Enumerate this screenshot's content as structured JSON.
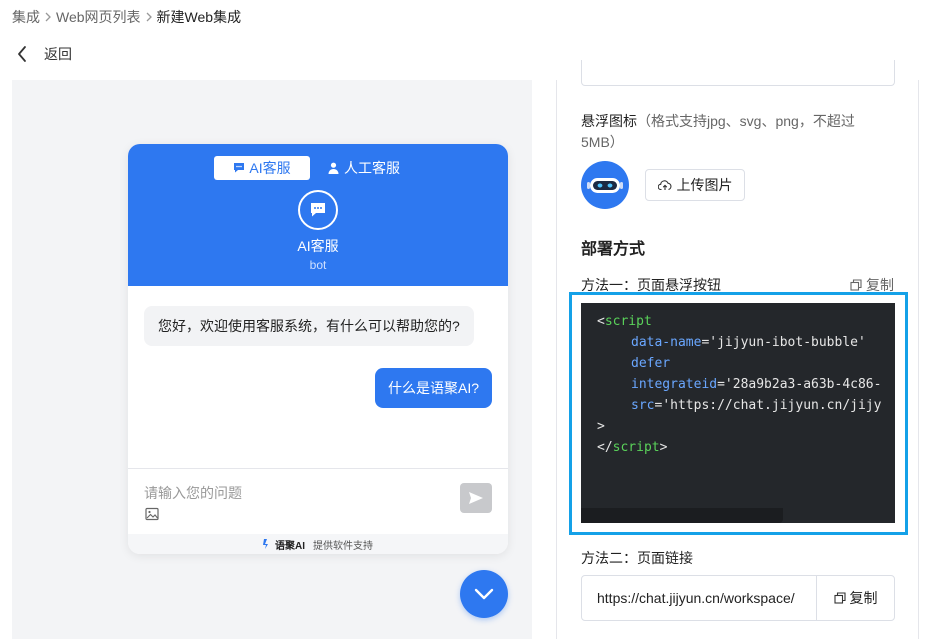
{
  "breadcrumb": {
    "items": [
      "集成",
      "Web网页列表",
      "新建Web集成"
    ]
  },
  "back": {
    "label": "返回"
  },
  "preview": {
    "tabs": {
      "ai": "AI客服",
      "human": "人工客服"
    },
    "bot": {
      "name": "AI客服",
      "subtitle": "bot"
    },
    "messages": {
      "incoming": "您好，欢迎使用客服系统，有什么可以帮助您的?",
      "outgoing": "什么是语聚AI?"
    },
    "input_placeholder": "请输入您的问题",
    "powered": {
      "brand": "语聚AI",
      "text": "提供软件支持"
    }
  },
  "settings": {
    "float_icon_label": "悬浮图标",
    "float_icon_hint": "（格式支持jpg、svg、png，不超过5MB）",
    "upload_label": "上传图片",
    "deploy_title": "部署方式",
    "method1_label": "方法一：页面悬浮按钮",
    "copy_label": "复制",
    "code": {
      "open_tag": "script",
      "attr_name": "data-name",
      "attr_name_val": "'jijyun-ibot-bubble'",
      "attr_defer": "defer",
      "attr_id": "integrateid",
      "attr_id_val": "'28a9b2a3-a63b-4c86-",
      "attr_src": "src",
      "attr_src_val": "'https://chat.jijyun.cn/jijy",
      "close_tag": "script"
    },
    "method2_label": "方法二：页面链接",
    "link_value": "https://chat.jijyun.cn/workspace/",
    "copy2_label": "复制"
  },
  "colors": {
    "primary": "#2e78f0",
    "highlight_border": "#14a1e8",
    "code_bg": "#24272b"
  }
}
